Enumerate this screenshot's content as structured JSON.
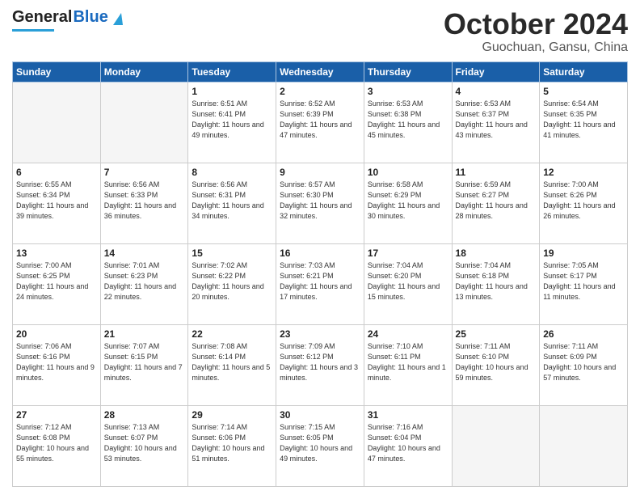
{
  "header": {
    "logo_general": "General",
    "logo_blue": "Blue",
    "title": "October 2024",
    "location": "Guochuan, Gansu, China"
  },
  "days_of_week": [
    "Sunday",
    "Monday",
    "Tuesday",
    "Wednesday",
    "Thursday",
    "Friday",
    "Saturday"
  ],
  "weeks": [
    [
      {
        "day": "",
        "info": ""
      },
      {
        "day": "",
        "info": ""
      },
      {
        "day": "1",
        "info": "Sunrise: 6:51 AM\nSunset: 6:41 PM\nDaylight: 11 hours and 49 minutes."
      },
      {
        "day": "2",
        "info": "Sunrise: 6:52 AM\nSunset: 6:39 PM\nDaylight: 11 hours and 47 minutes."
      },
      {
        "day": "3",
        "info": "Sunrise: 6:53 AM\nSunset: 6:38 PM\nDaylight: 11 hours and 45 minutes."
      },
      {
        "day": "4",
        "info": "Sunrise: 6:53 AM\nSunset: 6:37 PM\nDaylight: 11 hours and 43 minutes."
      },
      {
        "day": "5",
        "info": "Sunrise: 6:54 AM\nSunset: 6:35 PM\nDaylight: 11 hours and 41 minutes."
      }
    ],
    [
      {
        "day": "6",
        "info": "Sunrise: 6:55 AM\nSunset: 6:34 PM\nDaylight: 11 hours and 39 minutes."
      },
      {
        "day": "7",
        "info": "Sunrise: 6:56 AM\nSunset: 6:33 PM\nDaylight: 11 hours and 36 minutes."
      },
      {
        "day": "8",
        "info": "Sunrise: 6:56 AM\nSunset: 6:31 PM\nDaylight: 11 hours and 34 minutes."
      },
      {
        "day": "9",
        "info": "Sunrise: 6:57 AM\nSunset: 6:30 PM\nDaylight: 11 hours and 32 minutes."
      },
      {
        "day": "10",
        "info": "Sunrise: 6:58 AM\nSunset: 6:29 PM\nDaylight: 11 hours and 30 minutes."
      },
      {
        "day": "11",
        "info": "Sunrise: 6:59 AM\nSunset: 6:27 PM\nDaylight: 11 hours and 28 minutes."
      },
      {
        "day": "12",
        "info": "Sunrise: 7:00 AM\nSunset: 6:26 PM\nDaylight: 11 hours and 26 minutes."
      }
    ],
    [
      {
        "day": "13",
        "info": "Sunrise: 7:00 AM\nSunset: 6:25 PM\nDaylight: 11 hours and 24 minutes."
      },
      {
        "day": "14",
        "info": "Sunrise: 7:01 AM\nSunset: 6:23 PM\nDaylight: 11 hours and 22 minutes."
      },
      {
        "day": "15",
        "info": "Sunrise: 7:02 AM\nSunset: 6:22 PM\nDaylight: 11 hours and 20 minutes."
      },
      {
        "day": "16",
        "info": "Sunrise: 7:03 AM\nSunset: 6:21 PM\nDaylight: 11 hours and 17 minutes."
      },
      {
        "day": "17",
        "info": "Sunrise: 7:04 AM\nSunset: 6:20 PM\nDaylight: 11 hours and 15 minutes."
      },
      {
        "day": "18",
        "info": "Sunrise: 7:04 AM\nSunset: 6:18 PM\nDaylight: 11 hours and 13 minutes."
      },
      {
        "day": "19",
        "info": "Sunrise: 7:05 AM\nSunset: 6:17 PM\nDaylight: 11 hours and 11 minutes."
      }
    ],
    [
      {
        "day": "20",
        "info": "Sunrise: 7:06 AM\nSunset: 6:16 PM\nDaylight: 11 hours and 9 minutes."
      },
      {
        "day": "21",
        "info": "Sunrise: 7:07 AM\nSunset: 6:15 PM\nDaylight: 11 hours and 7 minutes."
      },
      {
        "day": "22",
        "info": "Sunrise: 7:08 AM\nSunset: 6:14 PM\nDaylight: 11 hours and 5 minutes."
      },
      {
        "day": "23",
        "info": "Sunrise: 7:09 AM\nSunset: 6:12 PM\nDaylight: 11 hours and 3 minutes."
      },
      {
        "day": "24",
        "info": "Sunrise: 7:10 AM\nSunset: 6:11 PM\nDaylight: 11 hours and 1 minute."
      },
      {
        "day": "25",
        "info": "Sunrise: 7:11 AM\nSunset: 6:10 PM\nDaylight: 10 hours and 59 minutes."
      },
      {
        "day": "26",
        "info": "Sunrise: 7:11 AM\nSunset: 6:09 PM\nDaylight: 10 hours and 57 minutes."
      }
    ],
    [
      {
        "day": "27",
        "info": "Sunrise: 7:12 AM\nSunset: 6:08 PM\nDaylight: 10 hours and 55 minutes."
      },
      {
        "day": "28",
        "info": "Sunrise: 7:13 AM\nSunset: 6:07 PM\nDaylight: 10 hours and 53 minutes."
      },
      {
        "day": "29",
        "info": "Sunrise: 7:14 AM\nSunset: 6:06 PM\nDaylight: 10 hours and 51 minutes."
      },
      {
        "day": "30",
        "info": "Sunrise: 7:15 AM\nSunset: 6:05 PM\nDaylight: 10 hours and 49 minutes."
      },
      {
        "day": "31",
        "info": "Sunrise: 7:16 AM\nSunset: 6:04 PM\nDaylight: 10 hours and 47 minutes."
      },
      {
        "day": "",
        "info": ""
      },
      {
        "day": "",
        "info": ""
      }
    ]
  ]
}
